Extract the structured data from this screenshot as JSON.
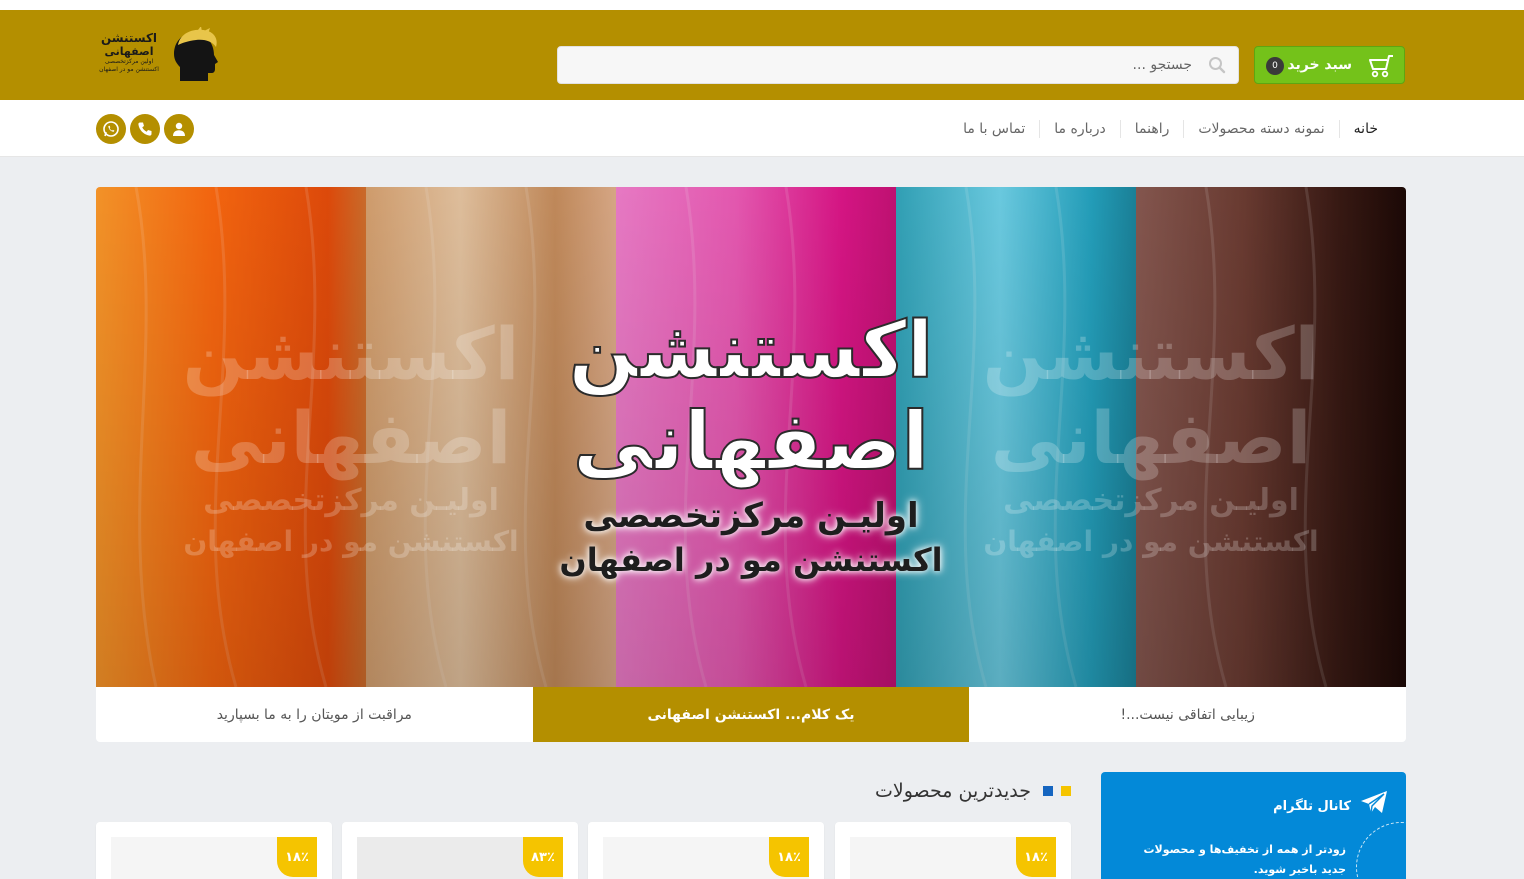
{
  "header": {
    "logo": {
      "line1": "اکستنشن",
      "line2": "اصفهانی",
      "line3": "اولین مرکزتخصصی",
      "line4": "اکستنشن مو در اصفهان"
    },
    "search_placeholder": "جستجو ...",
    "cart_label": "سبد خرید",
    "cart_count": "0"
  },
  "nav": {
    "items": [
      "خانه",
      "نمونه دسته محصولات",
      "راهنما",
      "درباره ما",
      "تماس با ما"
    ]
  },
  "slider": {
    "headline1": "اکستنشن",
    "headline2": "اصفهانی",
    "subline1": "اولیـن مرکزتخصصی",
    "subline2": "اکستنشن مو در اصفهان"
  },
  "tabs": [
    "زیبایی اتفاقی نیست...!",
    "یک کلام... اکستنشن اصفهانی",
    "مراقبت از مویتان را به ما بسپارید"
  ],
  "latest": {
    "title": "جدیدترین محصولات",
    "badges": [
      "۱۸٪",
      "۱۸٪",
      "۸۳٪",
      "۱۸٪"
    ]
  },
  "telegram": {
    "title": "کانال تلگرام",
    "desc": "زودتر از همه از تخفیف‌ها و محصولات جدید باخبر شوید."
  },
  "colors": {
    "brand": "#b48f00",
    "cart": "#74c21a",
    "badge": "#f5c400",
    "telegram": "#0389d8"
  }
}
